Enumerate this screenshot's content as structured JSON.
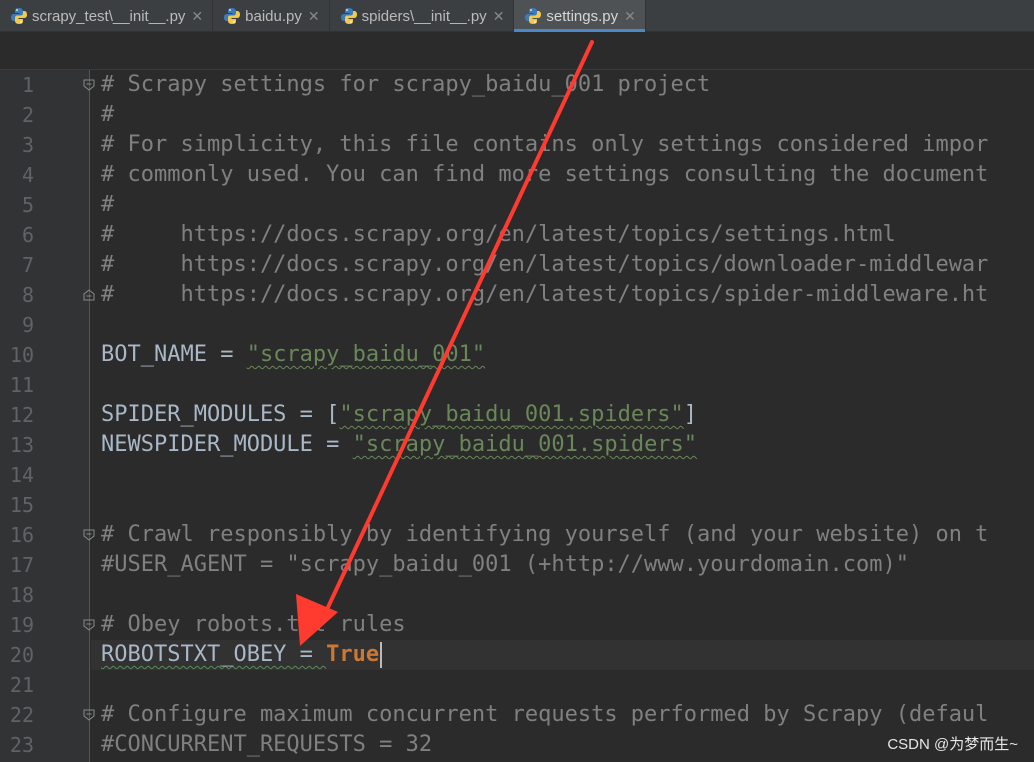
{
  "tabs": [
    {
      "label": "scrapy_test\\__init__.py",
      "active": false
    },
    {
      "label": "baidu.py",
      "active": false
    },
    {
      "label": "spiders\\__init__.py",
      "active": false
    },
    {
      "label": "settings.py",
      "active": true
    }
  ],
  "editor": {
    "line_numbers": [
      "1",
      "2",
      "3",
      "4",
      "5",
      "6",
      "7",
      "8",
      "9",
      "10",
      "11",
      "12",
      "13",
      "14",
      "15",
      "16",
      "17",
      "18",
      "19",
      "20",
      "21",
      "22",
      "23"
    ],
    "lines": [
      {
        "t": "# Scrapy settings for scrapy_baidu_001 project"
      },
      {
        "t": "#"
      },
      {
        "t": "# For simplicity, this file contains only settings considered impor"
      },
      {
        "t": "# commonly used. You can find more settings consulting the document"
      },
      {
        "t": "#"
      },
      {
        "t": "#     https://docs.scrapy.org/en/latest/topics/settings.html"
      },
      {
        "t": "#     https://docs.scrapy.org/en/latest/topics/downloader-middlewar"
      },
      {
        "t": "#     https://docs.scrapy.org/en/latest/topics/spider-middleware.ht"
      },
      {
        "t": ""
      },
      {
        "a": "BOT_NAME = ",
        "b": "\"scrapy_baidu_001\""
      },
      {
        "t": ""
      },
      {
        "a": "SPIDER_MODULES = [",
        "b": "\"scrapy_baidu_001.spiders\"",
        "c": "]"
      },
      {
        "a": "NEWSPIDER_MODULE = ",
        "b": "\"scrapy_baidu_001.spiders\""
      },
      {
        "t": ""
      },
      {
        "t": ""
      },
      {
        "t": "# Crawl responsibly by identifying yourself (and your website) on t"
      },
      {
        "t": "#USER_AGENT = \"scrapy_baidu_001 (+http://www.yourdomain.com)\""
      },
      {
        "t": ""
      },
      {
        "t": "# Obey robots.txt rules"
      },
      {
        "a": "ROBOTSTXT_OBEY = ",
        "k": "True"
      },
      {
        "t": ""
      },
      {
        "t": "# Configure maximum concurrent requests performed by Scrapy (defaul"
      },
      {
        "t": "#CONCURRENT_REQUESTS = 32"
      }
    ]
  },
  "watermark": "CSDN @为梦而生~",
  "colors": {
    "comment": "#808080",
    "string": "#6a8759",
    "keyword": "#cc7832",
    "text": "#a9b7c6",
    "background": "#2b2b2b",
    "annotation_arrow": "#ff3b30"
  },
  "icons": [
    "python-file-icon",
    "close-icon",
    "fold-marker-icon"
  ]
}
